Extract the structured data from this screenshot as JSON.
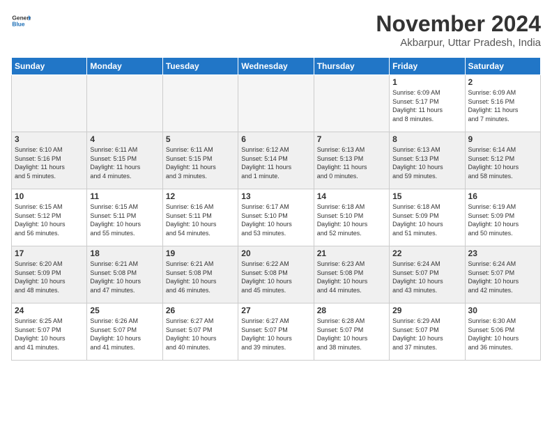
{
  "header": {
    "logo_general": "General",
    "logo_blue": "Blue",
    "month_title": "November 2024",
    "location": "Akbarpur, Uttar Pradesh, India"
  },
  "weekdays": [
    "Sunday",
    "Monday",
    "Tuesday",
    "Wednesday",
    "Thursday",
    "Friday",
    "Saturday"
  ],
  "weeks": [
    [
      {
        "day": "",
        "info": ""
      },
      {
        "day": "",
        "info": ""
      },
      {
        "day": "",
        "info": ""
      },
      {
        "day": "",
        "info": ""
      },
      {
        "day": "",
        "info": ""
      },
      {
        "day": "1",
        "info": "Sunrise: 6:09 AM\nSunset: 5:17 PM\nDaylight: 11 hours\nand 8 minutes."
      },
      {
        "day": "2",
        "info": "Sunrise: 6:09 AM\nSunset: 5:16 PM\nDaylight: 11 hours\nand 7 minutes."
      }
    ],
    [
      {
        "day": "3",
        "info": "Sunrise: 6:10 AM\nSunset: 5:16 PM\nDaylight: 11 hours\nand 5 minutes."
      },
      {
        "day": "4",
        "info": "Sunrise: 6:11 AM\nSunset: 5:15 PM\nDaylight: 11 hours\nand 4 minutes."
      },
      {
        "day": "5",
        "info": "Sunrise: 6:11 AM\nSunset: 5:15 PM\nDaylight: 11 hours\nand 3 minutes."
      },
      {
        "day": "6",
        "info": "Sunrise: 6:12 AM\nSunset: 5:14 PM\nDaylight: 11 hours\nand 1 minute."
      },
      {
        "day": "7",
        "info": "Sunrise: 6:13 AM\nSunset: 5:13 PM\nDaylight: 11 hours\nand 0 minutes."
      },
      {
        "day": "8",
        "info": "Sunrise: 6:13 AM\nSunset: 5:13 PM\nDaylight: 10 hours\nand 59 minutes."
      },
      {
        "day": "9",
        "info": "Sunrise: 6:14 AM\nSunset: 5:12 PM\nDaylight: 10 hours\nand 58 minutes."
      }
    ],
    [
      {
        "day": "10",
        "info": "Sunrise: 6:15 AM\nSunset: 5:12 PM\nDaylight: 10 hours\nand 56 minutes."
      },
      {
        "day": "11",
        "info": "Sunrise: 6:15 AM\nSunset: 5:11 PM\nDaylight: 10 hours\nand 55 minutes."
      },
      {
        "day": "12",
        "info": "Sunrise: 6:16 AM\nSunset: 5:11 PM\nDaylight: 10 hours\nand 54 minutes."
      },
      {
        "day": "13",
        "info": "Sunrise: 6:17 AM\nSunset: 5:10 PM\nDaylight: 10 hours\nand 53 minutes."
      },
      {
        "day": "14",
        "info": "Sunrise: 6:18 AM\nSunset: 5:10 PM\nDaylight: 10 hours\nand 52 minutes."
      },
      {
        "day": "15",
        "info": "Sunrise: 6:18 AM\nSunset: 5:09 PM\nDaylight: 10 hours\nand 51 minutes."
      },
      {
        "day": "16",
        "info": "Sunrise: 6:19 AM\nSunset: 5:09 PM\nDaylight: 10 hours\nand 50 minutes."
      }
    ],
    [
      {
        "day": "17",
        "info": "Sunrise: 6:20 AM\nSunset: 5:09 PM\nDaylight: 10 hours\nand 48 minutes."
      },
      {
        "day": "18",
        "info": "Sunrise: 6:21 AM\nSunset: 5:08 PM\nDaylight: 10 hours\nand 47 minutes."
      },
      {
        "day": "19",
        "info": "Sunrise: 6:21 AM\nSunset: 5:08 PM\nDaylight: 10 hours\nand 46 minutes."
      },
      {
        "day": "20",
        "info": "Sunrise: 6:22 AM\nSunset: 5:08 PM\nDaylight: 10 hours\nand 45 minutes."
      },
      {
        "day": "21",
        "info": "Sunrise: 6:23 AM\nSunset: 5:08 PM\nDaylight: 10 hours\nand 44 minutes."
      },
      {
        "day": "22",
        "info": "Sunrise: 6:24 AM\nSunset: 5:07 PM\nDaylight: 10 hours\nand 43 minutes."
      },
      {
        "day": "23",
        "info": "Sunrise: 6:24 AM\nSunset: 5:07 PM\nDaylight: 10 hours\nand 42 minutes."
      }
    ],
    [
      {
        "day": "24",
        "info": "Sunrise: 6:25 AM\nSunset: 5:07 PM\nDaylight: 10 hours\nand 41 minutes."
      },
      {
        "day": "25",
        "info": "Sunrise: 6:26 AM\nSunset: 5:07 PM\nDaylight: 10 hours\nand 41 minutes."
      },
      {
        "day": "26",
        "info": "Sunrise: 6:27 AM\nSunset: 5:07 PM\nDaylight: 10 hours\nand 40 minutes."
      },
      {
        "day": "27",
        "info": "Sunrise: 6:27 AM\nSunset: 5:07 PM\nDaylight: 10 hours\nand 39 minutes."
      },
      {
        "day": "28",
        "info": "Sunrise: 6:28 AM\nSunset: 5:07 PM\nDaylight: 10 hours\nand 38 minutes."
      },
      {
        "day": "29",
        "info": "Sunrise: 6:29 AM\nSunset: 5:07 PM\nDaylight: 10 hours\nand 37 minutes."
      },
      {
        "day": "30",
        "info": "Sunrise: 6:30 AM\nSunset: 5:06 PM\nDaylight: 10 hours\nand 36 minutes."
      }
    ]
  ]
}
